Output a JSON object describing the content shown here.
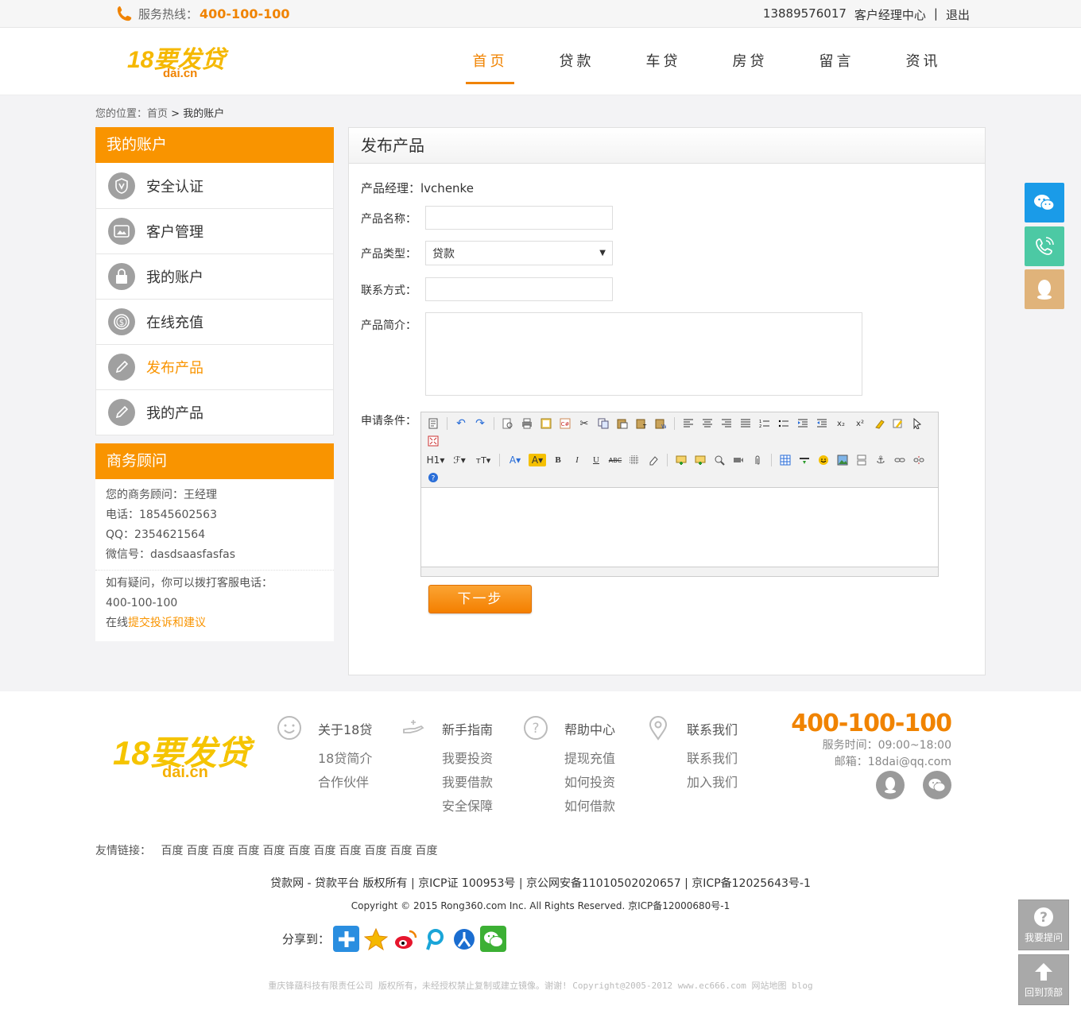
{
  "topbar": {
    "hotline_label": "服务热线：",
    "hotline_number": "400-100-100",
    "user_phone": "13889576017",
    "manager_center": "客户经理中心",
    "separator": "|",
    "logout": "退出"
  },
  "logo": {
    "text_top": "18要发贷",
    "text_bottom": "dai.cn"
  },
  "nav": [
    {
      "label": "首页",
      "active": true
    },
    {
      "label": "贷款"
    },
    {
      "label": "车贷"
    },
    {
      "label": "房贷"
    },
    {
      "label": "留言"
    },
    {
      "label": "资讯"
    }
  ],
  "breadcrumb": {
    "prefix": "您的位置：",
    "home": "首页",
    "sep": " > ",
    "current": "我的账户"
  },
  "sidebar": {
    "title": "我的账户",
    "items": [
      {
        "label": "安全认证",
        "icon": "shield-icon"
      },
      {
        "label": "客户管理",
        "icon": "id-card-icon"
      },
      {
        "label": "我的账户",
        "icon": "lock-icon"
      },
      {
        "label": "在线充值",
        "icon": "coin-icon"
      },
      {
        "label": "发布产品",
        "icon": "pencil-icon",
        "active": true
      },
      {
        "label": "我的产品",
        "icon": "pencil-icon"
      }
    ]
  },
  "advisor": {
    "title": "商务顾问",
    "name_line": "您的商务顾问：王经理",
    "phone_line": "电话：18545602563",
    "qq_line": "QQ：2354621564",
    "wechat_line": "微信号：dasdsaasfasfas",
    "help_line": "如有疑问，你可以拨打客服电话：",
    "help_number": "400-100-100",
    "online_prefix": "在线",
    "online_link": "提交投诉和建议"
  },
  "form": {
    "title": "发布产品",
    "manager_label": "产品经理：",
    "manager_value": "lvchenke",
    "name_label": "产品名称：",
    "name_value": "",
    "type_label": "产品类型：",
    "type_value": "贷款",
    "contact_label": "联系方式：",
    "contact_value": "",
    "intro_label": "产品简介：",
    "intro_value": "",
    "conditions_label": "申请条件：",
    "next_button": "下一步"
  },
  "footer": {
    "columns": [
      {
        "title": "关于18贷",
        "icon": "smile-icon",
        "links": [
          "18贷简介",
          "合作伙伴"
        ]
      },
      {
        "title": "新手指南",
        "icon": "hand-icon",
        "links": [
          "我要投资",
          "我要借款",
          "安全保障"
        ]
      },
      {
        "title": "帮助中心",
        "icon": "question-icon",
        "links": [
          "提现充值",
          "如何投资",
          "如何借款"
        ]
      },
      {
        "title": "联系我们",
        "icon": "location-icon",
        "links": [
          "联系我们",
          "加入我们"
        ]
      }
    ],
    "phone": "400-100-100",
    "service_time": "服务时间：09:00~18:00",
    "email": "邮箱：18dai@qq.com",
    "friend_label": "友情链接：",
    "friend_links": [
      "百度",
      "百度",
      "百度",
      "百度",
      "百度",
      "百度",
      "百度",
      "百度",
      "百度",
      "百度",
      "百度"
    ],
    "copyright1": "贷款网 - 贷款平台 版权所有 | 京ICP证 100953号 | 京公网安备11010502020657 | 京ICP备12025643号-1",
    "copyright2": "Copyright © 2015 Rong360.com Inc. All Rights Reserved. 京ICP备12000680号-1",
    "share_label": "分享到：",
    "copyright3": "重庆锋蕴科技有限责任公司 版权所有，未经授权禁止复制或建立镜像。谢谢! Copyright@2005-2012 www.ec666.com 网站地图 blog",
    "feedback": "我要提问",
    "back_top": "回到顶部"
  },
  "colors": {
    "accent": "#f99400",
    "wechat": "#1a9be8",
    "phone": "#4cc9a4",
    "qq": "#e0b37a"
  }
}
